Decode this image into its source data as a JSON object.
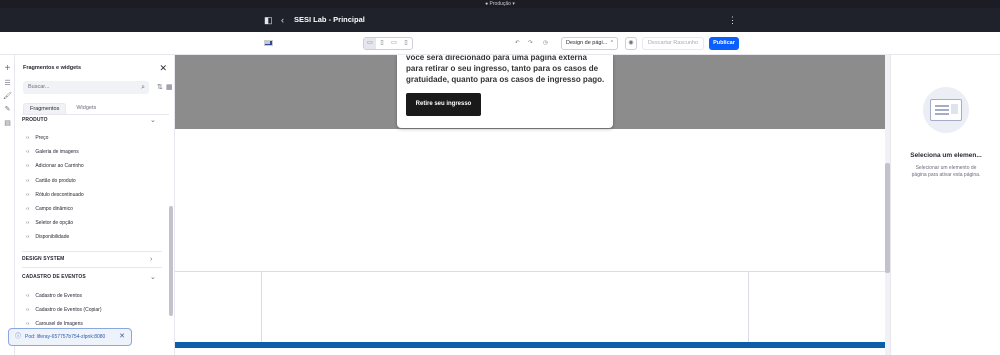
{
  "env_bar": {
    "label": "Produção",
    "icon": "chevron-down-icon"
  },
  "header": {
    "title": "SESI Lab - Principal",
    "icons": [
      "sidebar-toggle-icon",
      "back-icon",
      "kebab-menu-icon"
    ]
  },
  "toolbar": {
    "language_icon": "flag-icon",
    "devices": [
      "desktop",
      "tablet",
      "landscape-phone",
      "portrait-phone"
    ],
    "selected_device": "desktop",
    "undo_icon": "undo-icon",
    "redo_icon": "redo-icon",
    "history_icon": "history-icon",
    "experience_select": "Design de pági...",
    "preview_icon": "eye-icon",
    "discard_label": "Descartar Rascunho",
    "publish_label": "Publicar"
  },
  "left_rail": {
    "icons": [
      "add-icon",
      "page-structure-icon",
      "paint-icon",
      "look-feel-icon",
      "comments-icon"
    ]
  },
  "fragments_panel": {
    "title": "Fragmentos e widgets",
    "search_placeholder": "Buscar...",
    "tabs": [
      {
        "label": "Fragmentos",
        "active": true
      },
      {
        "label": "Widgets",
        "active": false
      }
    ],
    "sections": [
      {
        "label": "PRODUTO",
        "expanded": true,
        "items": [
          "Preço",
          "Galeria de imagens",
          "Adicionar ao Carrinho",
          "Cartão do produto",
          "Rótulo descontinuado",
          "Campo dinâmico",
          "Seletor de opção",
          "Disponibilidade"
        ]
      },
      {
        "label": "DESIGN SYSTEM",
        "expanded": false,
        "items": []
      },
      {
        "label": "CADASTRO DE EVENTOS",
        "expanded": true,
        "items": [
          "Cadastro de Eventos",
          "Cadastro de Eventos (Copiar)",
          "Carousel de Imagens"
        ]
      }
    ],
    "item_icon": "code-icon"
  },
  "canvas": {
    "card_text": "você será direcionado para uma página externa para retirar o seu ingresso, tanto para os casos de gratuidade, quanto para os casos de ingresso pago.",
    "cta_label": "Retire seu ingresso"
  },
  "right_panel": {
    "title": "Seleciona um elemen...",
    "description": "Selecionar um elemento de página para ativar esta página."
  },
  "toast": {
    "text": "Pod: liferay-657757b754-zlpnk:8080",
    "icon": "info-icon"
  },
  "colors": {
    "header_bg": "#1f222b",
    "accent": "#0b5fff",
    "hero_gray": "#8c8c8c",
    "footer_blue": "#0d5ea8"
  }
}
